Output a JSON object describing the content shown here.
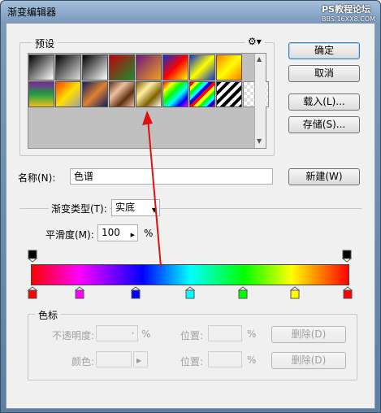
{
  "window": {
    "title": "渐变编辑器",
    "watermark": "PS教程论坛",
    "watermark_sub": "BBS.16XX8.COM"
  },
  "presets": {
    "legend": "预设",
    "gear_icon": "gear-icon"
  },
  "buttons": {
    "ok": "确定",
    "cancel": "取消",
    "load": "载入(L)...",
    "save": "存储(S)...",
    "new": "新建(W)",
    "delete1": "删除(D)",
    "delete2": "删除(D)"
  },
  "name": {
    "label": "名称(N):",
    "value": "色谱"
  },
  "gradient": {
    "type_label": "渐变类型(T):",
    "type_value": "实底",
    "smooth_label": "平滑度(M):",
    "smooth_value": "100",
    "smooth_unit": "%"
  },
  "stops": {
    "legend": "色标",
    "opacity_label": "不透明度:",
    "opacity_unit": "%",
    "position_label1": "位置:",
    "position_unit1": "%",
    "color_label": "颜色:",
    "position_label2": "位置:",
    "position_unit2": "%",
    "color_stop_colors": [
      "#ff0000",
      "#ff00ff",
      "#0000ff",
      "#00ffff",
      "#00ff00",
      "#ffff00",
      "#ff0000"
    ]
  },
  "colors": {
    "annotation_arrow": "#e01010"
  }
}
